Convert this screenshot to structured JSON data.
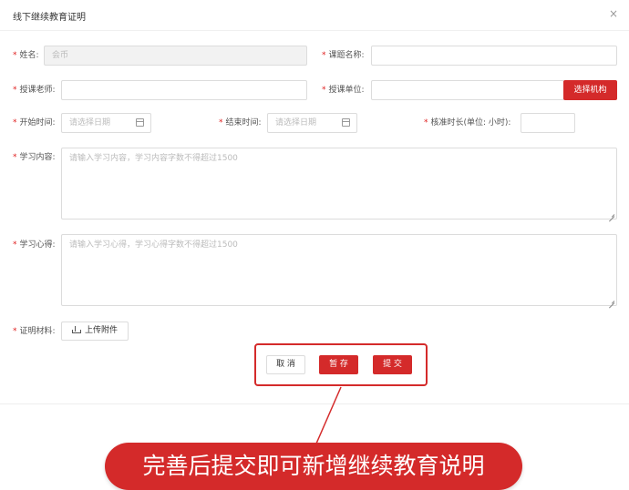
{
  "dialog": {
    "title": "线下继续教育证明",
    "close_icon": "×"
  },
  "form": {
    "name": {
      "label": "姓名:",
      "value": "会币"
    },
    "course_name": {
      "label": "课题名称:",
      "value": ""
    },
    "teacher": {
      "label": "授课老师:",
      "value": ""
    },
    "unit": {
      "label": "授课单位:",
      "value": "",
      "button": "选择机构"
    },
    "start_time": {
      "label": "开始时间:",
      "placeholder": "请选择日期"
    },
    "end_time": {
      "label": "结束时间:",
      "placeholder": "请选择日期"
    },
    "hours": {
      "label": "核准时长(单位: 小时):",
      "value": ""
    },
    "content": {
      "label": "学习内容:",
      "placeholder": "请输入学习内容，学习内容字数不得超过1500"
    },
    "experience": {
      "label": "学习心得:",
      "placeholder": "请输入学习心得，学习心得字数不得超过1500"
    },
    "material": {
      "label": "证明材料:",
      "button": "上传附件"
    },
    "required_mark": "*"
  },
  "actions": {
    "cancel": "取 消",
    "save": "暂 存",
    "submit": "提 交"
  },
  "annotation": {
    "text": "完善后提交即可新增继续教育说明",
    "color": "#d42a2a"
  }
}
